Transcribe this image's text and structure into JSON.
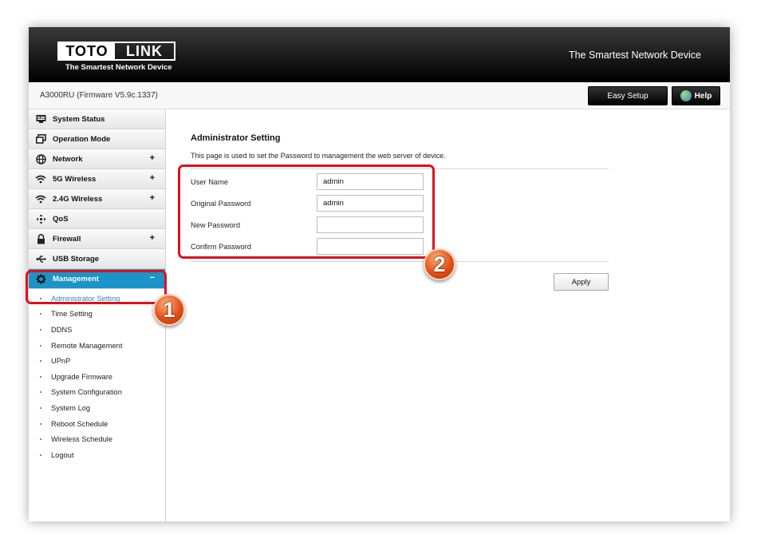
{
  "header": {
    "logo_left": "TOTO",
    "logo_right": "LINK",
    "logo_tagline": "The Smartest Network Device",
    "tagline": "The Smartest Network Device"
  },
  "subbar": {
    "model": "A3000RU (Firmware V5.9c.1337)",
    "easy_setup": "Easy Setup",
    "help": "Help"
  },
  "sidebar": {
    "items": [
      {
        "label": "System Status",
        "icon": "monitor-icon",
        "expandable": false
      },
      {
        "label": "Operation Mode",
        "icon": "windows-icon",
        "expandable": false
      },
      {
        "label": "Network",
        "icon": "globe-icon",
        "expandable": true
      },
      {
        "label": "5G Wireless",
        "icon": "wifi-icon",
        "expandable": true
      },
      {
        "label": "2.4G Wireless",
        "icon": "wifi-icon",
        "expandable": true
      },
      {
        "label": "QoS",
        "icon": "qos-icon",
        "expandable": false
      },
      {
        "label": "Firewall",
        "icon": "lock-icon",
        "expandable": true
      },
      {
        "label": "USB Storage",
        "icon": "usb-icon",
        "expandable": false
      },
      {
        "label": "Management",
        "icon": "gear-icon",
        "expandable": true
      }
    ],
    "plus": "+",
    "minus": "−",
    "management_subitems": [
      "Administrator Setting",
      "Time Setting",
      "DDNS",
      "Remote Management",
      "UPnP",
      "Upgrade Firmware",
      "System Configuration",
      "System Log",
      "Reboot Schedule",
      "Wireless Schedule",
      "Logout"
    ]
  },
  "main": {
    "title": "Administrator Setting",
    "description": "This page is used to set the Password to management the web server of device.",
    "fields": [
      {
        "label": "User Name",
        "value": "admin"
      },
      {
        "label": "Original Password",
        "value": "admin"
      },
      {
        "label": "New Password",
        "value": ""
      },
      {
        "label": "Confirm Password",
        "value": ""
      }
    ],
    "apply": "Apply"
  },
  "annotations": {
    "badge_1": "1",
    "badge_2": "2",
    "color": "#e0101a"
  },
  "colors": {
    "accent": "#1a94c9",
    "header_bg": "#111111"
  }
}
